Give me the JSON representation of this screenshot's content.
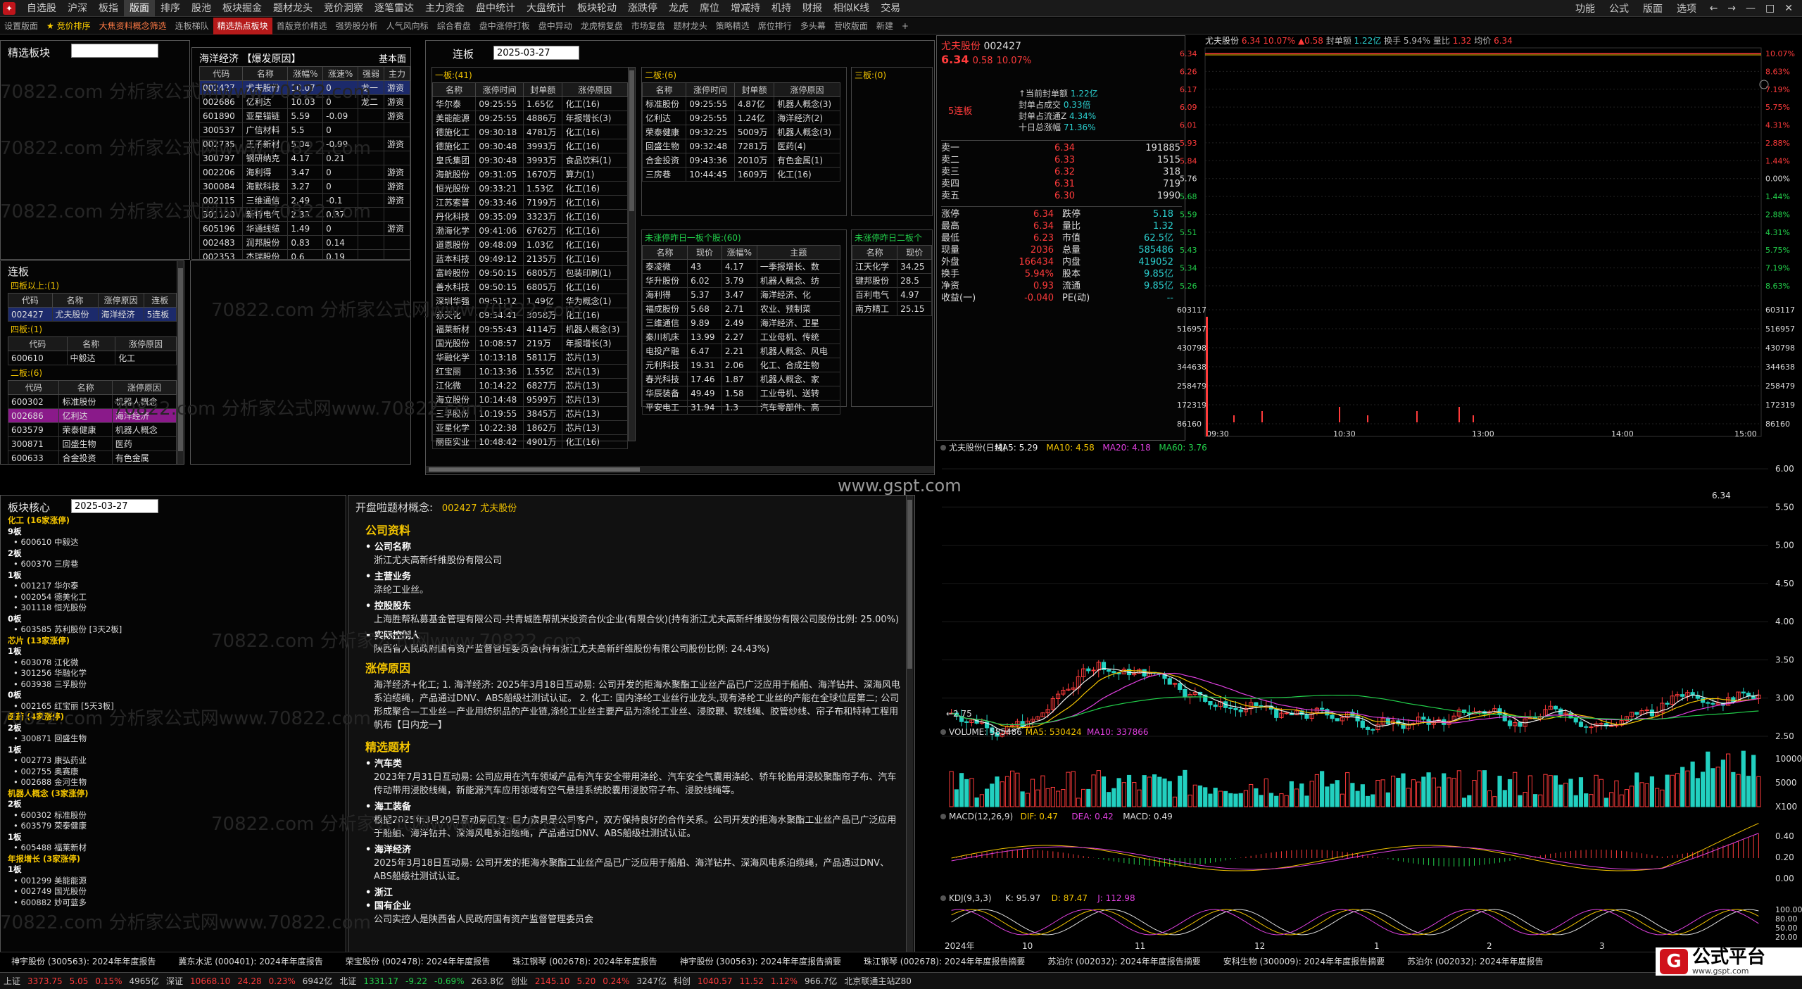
{
  "menu": [
    "自选股",
    "沪深",
    "板指",
    "版面",
    "排序",
    "股池",
    "板块掘金",
    "题材龙头",
    "竞价洞察",
    "逐笔雷达",
    "主力资金",
    "盘中统计",
    "大盘统计",
    "板块轮动",
    "涨跌停",
    "龙虎",
    "席位",
    "增减持",
    "机持",
    "财报",
    "相似K线",
    "交易"
  ],
  "menu_active": 3,
  "rmenu": [
    "功能",
    "公式",
    "版面",
    "选项"
  ],
  "window_controls": [
    "←",
    "→",
    "—",
    "□",
    "✕"
  ],
  "tabs": [
    {
      "t": "设置版面",
      "c": ""
    },
    {
      "t": "★ 竞价排序",
      "c": "yel"
    },
    {
      "t": "大焦资料概念筛选",
      "c": "hot"
    },
    {
      "t": "连板梯队",
      "c": ""
    },
    {
      "t": "精选热点板块",
      "c": "sel"
    },
    {
      "t": "首版竞价精选",
      "c": ""
    },
    {
      "t": "强势股分析",
      "c": ""
    },
    {
      "t": "人气风向标",
      "c": ""
    },
    {
      "t": "综合看盘",
      "c": ""
    },
    {
      "t": "盘中涨停打板",
      "c": ""
    },
    {
      "t": "盘中异动",
      "c": ""
    },
    {
      "t": "龙虎榜复盘",
      "c": ""
    },
    {
      "t": "市场复盘",
      "c": ""
    },
    {
      "t": "题材龙头",
      "c": ""
    },
    {
      "t": "策略精选",
      "c": ""
    },
    {
      "t": "席位排行",
      "c": ""
    },
    {
      "t": "多头幕",
      "c": ""
    },
    {
      "t": "营收版面",
      "c": ""
    },
    {
      "t": "新建",
      "c": ""
    },
    {
      "t": "+",
      "c": ""
    }
  ],
  "watermark": "70822.com  分析家公式网www.70822.com",
  "center_wm": "www.gspt.com",
  "jx": {
    "title": "精选板块"
  },
  "hy": {
    "title": "海洋经济 【爆发原因】",
    "basic": "基本面",
    "headers": [
      "代码",
      "名称",
      "涨幅%",
      "涨速%",
      "强弱",
      "主力"
    ],
    "rows": [
      [
        "002427",
        "尤夫股份",
        "10.07",
        "0",
        "龙一",
        "游资"
      ],
      [
        "002686",
        "亿利达",
        "10.03",
        "0",
        "龙二",
        "游资"
      ],
      [
        "601890",
        "亚星锚链",
        "5.59",
        "-0.09",
        "",
        "游资"
      ],
      [
        "300537",
        "广信材料",
        "5.5",
        "0",
        "",
        ""
      ],
      [
        "002735",
        "王子新材",
        "5.04",
        "-0.99",
        "",
        "游资"
      ],
      [
        "300797",
        "钢研纳克",
        "4.17",
        "0.21",
        "",
        ""
      ],
      [
        "002206",
        "海利得",
        "3.47",
        "0",
        "",
        "游资"
      ],
      [
        "300084",
        "海默科技",
        "3.27",
        "0",
        "",
        "游资"
      ],
      [
        "002115",
        "三维通信",
        "2.49",
        "-0.1",
        "",
        "游资"
      ],
      [
        "301120",
        "新特电气",
        "2.33",
        "0.37",
        "",
        ""
      ],
      [
        "605196",
        "华通线缆",
        "1.49",
        "0",
        "",
        "游资"
      ],
      [
        "002483",
        "润邦股份",
        "0.83",
        "0.14",
        "",
        ""
      ],
      [
        "002353",
        "杰瑞股份",
        "0.6",
        "0.19",
        "",
        ""
      ]
    ]
  },
  "lb": {
    "title": "连板",
    "date": "2025-03-27",
    "one": {
      "title": "一板:",
      "count": "(41)",
      "headers": [
        "名称",
        "涨停时间",
        "封单额",
        "涨停原因"
      ],
      "rows": [
        [
          "华尔泰",
          "09:25:55",
          "1.65亿",
          "化工(16)"
        ],
        [
          "美能能源",
          "09:25:55",
          "4886万",
          "年报增长(3)"
        ],
        [
          "德施化工",
          "09:30:18",
          "4781万",
          "化工(16)"
        ],
        [
          "德施化工",
          "09:30:48",
          "3993万",
          "化工(16)"
        ],
        [
          "皇氏集团",
          "09:30:48",
          "3993万",
          "食品饮料(1)"
        ],
        [
          "海航股份",
          "09:31:05",
          "1670万",
          "算力(1)"
        ],
        [
          "恒光股份",
          "09:33:21",
          "1.53亿",
          "化工(16)"
        ],
        [
          "江苏索普",
          "09:33:46",
          "7199万",
          "化工(16)"
        ],
        [
          "丹化科技",
          "09:35:09",
          "3323万",
          "化工(16)"
        ],
        [
          "渤海化学",
          "09:41:06",
          "6762万",
          "化工(16)"
        ],
        [
          "道恩股份",
          "09:48:09",
          "1.03亿",
          "化工(16)"
        ],
        [
          "蓝本科技",
          "09:49:12",
          "2135万",
          "化工(16)"
        ],
        [
          "富岭股份",
          "09:50:15",
          "6805万",
          "包装印刷(1)"
        ],
        [
          "善水科技",
          "09:50:15",
          "6805万",
          "化工(16)"
        ],
        [
          "深圳华强",
          "09:51:12",
          "1.49亿",
          "华为概念(1)"
        ],
        [
          "赤天化",
          "09:54:41",
          "3058万",
          "化工(16)"
        ],
        [
          "福莱新材",
          "09:55:43",
          "4114万",
          "机器人概念(3)"
        ],
        [
          "国光股份",
          "10:08:57",
          "219万",
          "年报增长(3)"
        ],
        [
          "华融化学",
          "10:13:18",
          "5811万",
          "芯片(13)"
        ],
        [
          "红宝丽",
          "10:13:36",
          "1.55亿",
          "芯片(13)"
        ],
        [
          "江化微",
          "10:14:22",
          "6827万",
          "芯片(13)"
        ],
        [
          "海立股份",
          "10:14:48",
          "9599万",
          "芯片(13)"
        ],
        [
          "三孚股份",
          "10:19:55",
          "3845万",
          "芯片(13)"
        ],
        [
          "亚星化学",
          "10:22:38",
          "1862万",
          "芯片(13)"
        ],
        [
          "丽臣实业",
          "10:48:42",
          "4901万",
          "化工(16)"
        ]
      ]
    },
    "two": {
      "title": "二板:",
      "count": "(6)",
      "headers": [
        "名称",
        "涨停时间",
        "封单额",
        "涨停原因"
      ],
      "rows": [
        [
          "标准股份",
          "09:25:55",
          "4.87亿",
          "机器人概念(3)"
        ],
        [
          "亿利达",
          "09:25:55",
          "1.24亿",
          "海洋经济(2)"
        ],
        [
          "荣泰健康",
          "09:32:25",
          "5009万",
          "机器人概念(3)"
        ],
        [
          "回盛生物",
          "09:32:48",
          "7281万",
          "医药(4)"
        ],
        [
          "合金投资",
          "09:43:36",
          "2010万",
          "有色金属(1)"
        ],
        [
          "三房巷",
          "10:44:45",
          "1609万",
          "化工(16)"
        ]
      ]
    },
    "three": {
      "title": "三板:",
      "count": "(0)"
    },
    "notyet1": {
      "title": "未涨停昨日一板个股:",
      "count": "(60)",
      "headers": [
        "名称",
        "现价",
        "涨幅%",
        "主题"
      ],
      "rows": [
        [
          "泰凌微",
          "43",
          "4.17",
          "一季报增长、数"
        ],
        [
          "华升股份",
          "6.02",
          "3.79",
          "机器人概念、纺"
        ],
        [
          "海利得",
          "5.37",
          "3.47",
          "海洋经济、化"
        ],
        [
          "福成股份",
          "5.68",
          "2.71",
          "农业、预制菜"
        ],
        [
          "三维通信",
          "9.89",
          "2.49",
          "海洋经济、卫星"
        ],
        [
          "秦川机床",
          "13.99",
          "2.27",
          "工业母机、传统"
        ],
        [
          "电投产融",
          "6.47",
          "2.21",
          "机器人概念、风电"
        ],
        [
          "元利科技",
          "19.31",
          "2.06",
          "化工、合成生物"
        ],
        [
          "春光科技",
          "17.46",
          "1.87",
          "机器人概念、家"
        ],
        [
          "华辰装备",
          "49.49",
          "1.58",
          "工业母机、送转"
        ],
        [
          "平安电工",
          "31.94",
          "1.3",
          "汽车零部件、高"
        ]
      ]
    },
    "notyet2": {
      "title": "未涨停昨日二板个",
      "headers": [
        "名称",
        "现价"
      ],
      "rows": [
        [
          "江天化学",
          "34.25"
        ],
        [
          "键邦股份",
          "28.5"
        ],
        [
          "百利电气",
          "4.97"
        ],
        [
          "南方精工",
          "25.15"
        ]
      ]
    }
  },
  "lbl": {
    "title": "连板",
    "g4p": {
      "title": "四板以上:",
      "count": "(1)",
      "headers": [
        "代码",
        "名称",
        "涨停原因",
        "连板"
      ],
      "rows": [
        [
          "002427",
          "尤夫股份",
          "海洋经济",
          "5连板"
        ]
      ]
    },
    "g4": {
      "title": "四板:",
      "count": "(1)",
      "headers": [
        "代码",
        "名称",
        "涨停原因"
      ],
      "rows": [
        [
          "600610",
          "中毅达",
          "化工"
        ]
      ]
    },
    "g2": {
      "title": "二板:",
      "count": "(6)",
      "headers": [
        "代码",
        "名称",
        "涨停原因"
      ],
      "rows": [
        [
          "600302",
          "标准股份",
          "机器人概念"
        ],
        [
          "002686",
          "亿利达",
          "海洋经济"
        ],
        [
          "603579",
          "荣泰健康",
          "机器人概念"
        ],
        [
          "300871",
          "回盛生物",
          "医药"
        ],
        [
          "600633",
          "合金投资",
          "有色金属"
        ]
      ]
    }
  },
  "core": {
    "title": "板块核心",
    "date": "2025-03-27",
    "tree": [
      {
        "t": "化工",
        "n": "(16家涨停)",
        "k": "cat"
      },
      {
        "t": "9板",
        "k": "lv"
      },
      {
        "t": "600610 中毅达",
        "k": "it"
      },
      {
        "t": "2板",
        "k": "lv"
      },
      {
        "t": "600370 三房巷",
        "k": "it"
      },
      {
        "t": "1板",
        "k": "lv"
      },
      {
        "t": "001217 华尔泰",
        "k": "it"
      },
      {
        "t": "002054 德美化工",
        "k": "it"
      },
      {
        "t": "301118 恒光股份",
        "k": "it"
      },
      {
        "t": "0板",
        "k": "lv"
      },
      {
        "t": "603585 苏利股份 [3天2板]",
        "k": "it"
      },
      {
        "t": "芯片",
        "n": "(13家涨停)",
        "k": "cat"
      },
      {
        "t": "1板",
        "k": "lv"
      },
      {
        "t": "603078 江化微",
        "k": "it"
      },
      {
        "t": "301256 华融化学",
        "k": "it"
      },
      {
        "t": "603938 三孚股份",
        "k": "it"
      },
      {
        "t": "0板",
        "k": "lv"
      },
      {
        "t": "002165 红宝丽 [5天3板]",
        "k": "it"
      },
      {
        "t": "医药",
        "n": "(4家涨停)",
        "k": "cat"
      },
      {
        "t": "2板",
        "k": "lv"
      },
      {
        "t": "300871 回盛生物",
        "k": "it"
      },
      {
        "t": "1板",
        "k": "lv"
      },
      {
        "t": "002773 康弘药业",
        "k": "it"
      },
      {
        "t": "002755 奥赛康",
        "k": "it"
      },
      {
        "t": "002688 金河生物",
        "k": "it"
      },
      {
        "t": "机器人概念",
        "n": "(3家涨停)",
        "k": "cat"
      },
      {
        "t": "2板",
        "k": "lv"
      },
      {
        "t": "600302 标准股份",
        "k": "it"
      },
      {
        "t": "603579 荣泰健康",
        "k": "it"
      },
      {
        "t": "1板",
        "k": "lv"
      },
      {
        "t": "605488 福莱新材",
        "k": "it"
      },
      {
        "t": "年报增长",
        "n": "(3家涨停)",
        "k": "cat"
      },
      {
        "t": "1板",
        "k": "lv"
      },
      {
        "t": "001299 美能能源",
        "k": "it"
      },
      {
        "t": "002749 国光股份",
        "k": "it"
      },
      {
        "t": "600882 妙可蓝多",
        "k": "it"
      }
    ]
  },
  "news": {
    "head": "开盘啦题材概念:",
    "code": "002427",
    "name": "尤夫股份",
    "sections": [
      {
        "h": "公司资料",
        "items": [
          {
            "k": "公司名称",
            "v": "浙江尤夫高新纤维股份有限公司"
          },
          {
            "k": "主营业务",
            "v": "涤纶工业丝。"
          },
          {
            "k": "控股股东",
            "v": "上海胜帮私募基金管理有限公司-共青城胜帮凯米投资合伙企业(有限合伙)(持有浙江尤夫高新纤维股份有限公司股份比例: 25.00%)"
          },
          {
            "k": "实际控制人",
            "v": "陕西省人民政府国有资产监督管理委员会(持有浙江尤夫高新纤维股份有限公司股份比例: 24.43%)"
          }
        ]
      },
      {
        "h": "涨停原因",
        "text": "海洋经济+化工; 1. 海洋经济: 2025年3月18日互动易: 公司开发的拒海水聚酯工业丝产品已广泛应用于船舶、海洋钻井、深海风电系泊缆绳，产品通过DNV、ABS船级社测试认证。 2. 化工: 国内涤纶工业丝行业龙头,现有涤纶工业丝的产能在全球位居第二; 公司形成聚合—工业丝—产业用纺织品的产业链,涤纶工业丝主要产品为涤纶工业丝、浸胶鞭、软线绳、胶管纱线、帘子布和特种工程用帆布【日内龙一】"
      },
      {
        "h": "精选题材",
        "items": [
          {
            "k": "汽车类",
            "v": "2023年7月31日互动易: 公司应用在汽车领域产品有汽车安全带用涤纶、汽车安全气囊用涤纶、轿车轮胎用浸胶聚酯帘子布、汽车传动带用浸胶线绳，新能源汽车应用领域有空气悬挂系统胶囊用浸胶帘子布、浸胶线绳等。"
          },
          {
            "k": "海工装备",
            "v": "根据2025年3月20日互动易回复: 巨力索具是公司客户，双方保持良好的合作关系。公司开发的拒海水聚酯工业丝产品已广泛应用于船舶、海洋钻井、深海风电系泊缆绳，产品通过DNV、ABS船级社测试认证。"
          },
          {
            "k": "海洋经济",
            "v": "2025年3月18日互动易: 公司开发的拒海水聚酯工业丝产品已广泛应用于船舶、海洋钻井、深海风电系泊缆绳，产品通过DNV、ABS船级社测试认证。"
          },
          {
            "k": "浙江",
            "v": ""
          },
          {
            "k": "国有企业",
            "v": "公司实控人是陕西省人民政府国有资产监督管理委员会"
          }
        ]
      }
    ]
  },
  "quote": {
    "name": "尤夫股份",
    "code": "002427",
    "price": "6.34",
    "chg": "0.58",
    "pct": "10.07%",
    "streak": "5连板",
    "seal": [
      [
        "↑当前封单额",
        "1.22亿"
      ],
      [
        "封单占成交",
        "0.33倍"
      ],
      [
        "封单占流通Z",
        "4.34%"
      ],
      [
        "十日总涨幅",
        "71.36%"
      ]
    ],
    "asks": [
      [
        "卖一",
        "6.34",
        "191885"
      ],
      [
        "卖二",
        "6.33",
        "1515"
      ],
      [
        "卖三",
        "6.32",
        "318"
      ],
      [
        "卖四",
        "6.31",
        "719"
      ],
      [
        "卖五",
        "6.30",
        "1990"
      ]
    ],
    "stats": [
      [
        "涨停",
        "6.34",
        "跌停",
        "5.18"
      ],
      [
        "最高",
        "6.34",
        "量比",
        "1.32"
      ],
      [
        "最低",
        "6.23",
        "市值",
        "62.5亿"
      ],
      [
        "现量",
        "2036",
        "总量",
        "585486"
      ],
      [
        "外盘",
        "166434",
        "内盘",
        "419052"
      ],
      [
        "换手",
        "5.94%",
        "股本",
        "9.85亿"
      ],
      [
        "净资",
        "0.93",
        "流通",
        "9.85亿"
      ],
      [
        "收益(一)",
        "-0.040",
        "PE(动)",
        "--"
      ]
    ]
  },
  "intraday": {
    "header_name": "尤夫股份",
    "header_parts": [
      [
        "6.34",
        "red"
      ],
      [
        "10.07%",
        "red"
      ],
      [
        "▲0.58",
        "red"
      ],
      [
        "封单额",
        "gray"
      ],
      [
        "1.22亿",
        "cyan"
      ],
      [
        "换手 5.94%",
        "gray"
      ],
      [
        "量比",
        "gray"
      ],
      [
        "1.32",
        "red"
      ],
      [
        "均价",
        "gray"
      ],
      [
        "6.34",
        "red"
      ]
    ],
    "ylabels": [
      "6.34",
      "6.26",
      "6.17",
      "6.09",
      "6.01",
      "5.93",
      "5.84",
      "5.76",
      "5.68",
      "5.59",
      "5.51",
      "5.43",
      "5.34",
      "5.26"
    ],
    "pct": [
      "10.07%",
      "8.63%",
      "7.19%",
      "5.75%",
      "4.31%",
      "2.88%",
      "1.44%",
      "0.00%",
      "1.44%",
      "2.88%",
      "4.31%",
      "5.75%",
      "7.19%",
      "8.63%"
    ],
    "vol": [
      "603117",
      "516957",
      "430798",
      "344638",
      "258479",
      "172319",
      "86160"
    ],
    "times": [
      "09:30",
      "10:30",
      "13:00",
      "14:00",
      "15:00"
    ]
  },
  "kline": {
    "legend": [
      [
        "尤夫股份(日线)",
        "#ddd"
      ],
      [
        "MA5: 5.29",
        "#f0f0f0"
      ],
      [
        "MA10: 4.58",
        "#f3c400"
      ],
      [
        "MA20: 4.18",
        "#e040e0"
      ],
      [
        "MA60: 3.76",
        "#22d04b"
      ]
    ],
    "prices": [
      "6.00",
      "5.50",
      "5.00",
      "4.50",
      "4.00",
      "3.50",
      "3.00",
      "2.50"
    ],
    "hi_label": "6.34",
    "lo_label": "←2.75",
    "vol_legend": [
      [
        "VOLUME: 585486",
        "#ddd"
      ],
      [
        "MA5: 530424",
        "#f3c400"
      ],
      [
        "MA10: 337866",
        "#e040e0"
      ]
    ],
    "vol_ticks": [
      "10000",
      "5000",
      "X100"
    ],
    "macd_legend": [
      [
        "MACD(12,26,9)",
        "#ddd"
      ],
      [
        "DIF: 0.47",
        "#f3c400"
      ],
      [
        "DEA: 0.42",
        "#e040e0"
      ],
      [
        "MACD: 0.49",
        "#ddd"
      ]
    ],
    "macd_ticks": [
      "0.40",
      "0.20",
      "0.00"
    ],
    "kdj_legend": [
      [
        "KDJ(9,3,3)",
        "#ddd"
      ],
      [
        "K: 95.97",
        "#ddd"
      ],
      [
        "D: 87.47",
        "#f3c400"
      ],
      [
        "J: 112.98",
        "#e040e0"
      ]
    ],
    "kdj_ticks": [
      "100.00",
      "80.00",
      "50.00",
      "20.00"
    ],
    "dates": [
      "2024年",
      "10",
      "11",
      "12",
      "1",
      "2",
      "3"
    ]
  },
  "ticker": [
    "神宇股份 (300563): 2024年年度报告",
    "冀东水泥 (000401): 2024年年度报告",
    "荣宝股份 (002478): 2024年年度报告",
    "珠江钢琴 (002678): 2024年年度报告",
    "神宇股份 (300563): 2024年年度报告摘要",
    "珠江钢琴 (002678): 2024年年度报告摘要",
    "苏泊尔 (002032): 2024年年度报告摘要",
    "安科生物 (300009): 2024年年度报告摘要",
    "苏泊尔 (002032): 2024年年度报告"
  ],
  "status": [
    [
      "上证",
      "#ccc"
    ],
    [
      "3373.75",
      "#ff3b3b"
    ],
    [
      "5.05",
      "#ff3b3b"
    ],
    [
      "0.15%",
      "#ff3b3b"
    ],
    [
      "4965亿",
      "#ccc"
    ],
    [
      "深证",
      "#ccc"
    ],
    [
      "10668.10",
      "#ff3b3b"
    ],
    [
      "24.28",
      "#ff3b3b"
    ],
    [
      "0.23%",
      "#ff3b3b"
    ],
    [
      "6942亿",
      "#ccc"
    ],
    [
      "北证",
      "#ccc"
    ],
    [
      "1331.17",
      "#22d04b"
    ],
    [
      "-9.22",
      "#22d04b"
    ],
    [
      "-0.69%",
      "#22d04b"
    ],
    [
      "263.8亿",
      "#ccc"
    ],
    [
      "创业",
      "#ccc"
    ],
    [
      "2145.10",
      "#ff3b3b"
    ],
    [
      "5.20",
      "#ff3b3b"
    ],
    [
      "0.24%",
      "#ff3b3b"
    ],
    [
      "3247亿",
      "#ccc"
    ],
    [
      "科创",
      "#ccc"
    ],
    [
      "1040.57",
      "#ff3b3b"
    ],
    [
      "11.52",
      "#ff3b3b"
    ],
    [
      "1.12%",
      "#ff3b3b"
    ],
    [
      "966.7亿",
      "#ccc"
    ],
    [
      "北京联通主站Z80",
      "#ccc"
    ]
  ],
  "brand": {
    "t": "公式平台",
    "url": "www.gspt.com"
  }
}
